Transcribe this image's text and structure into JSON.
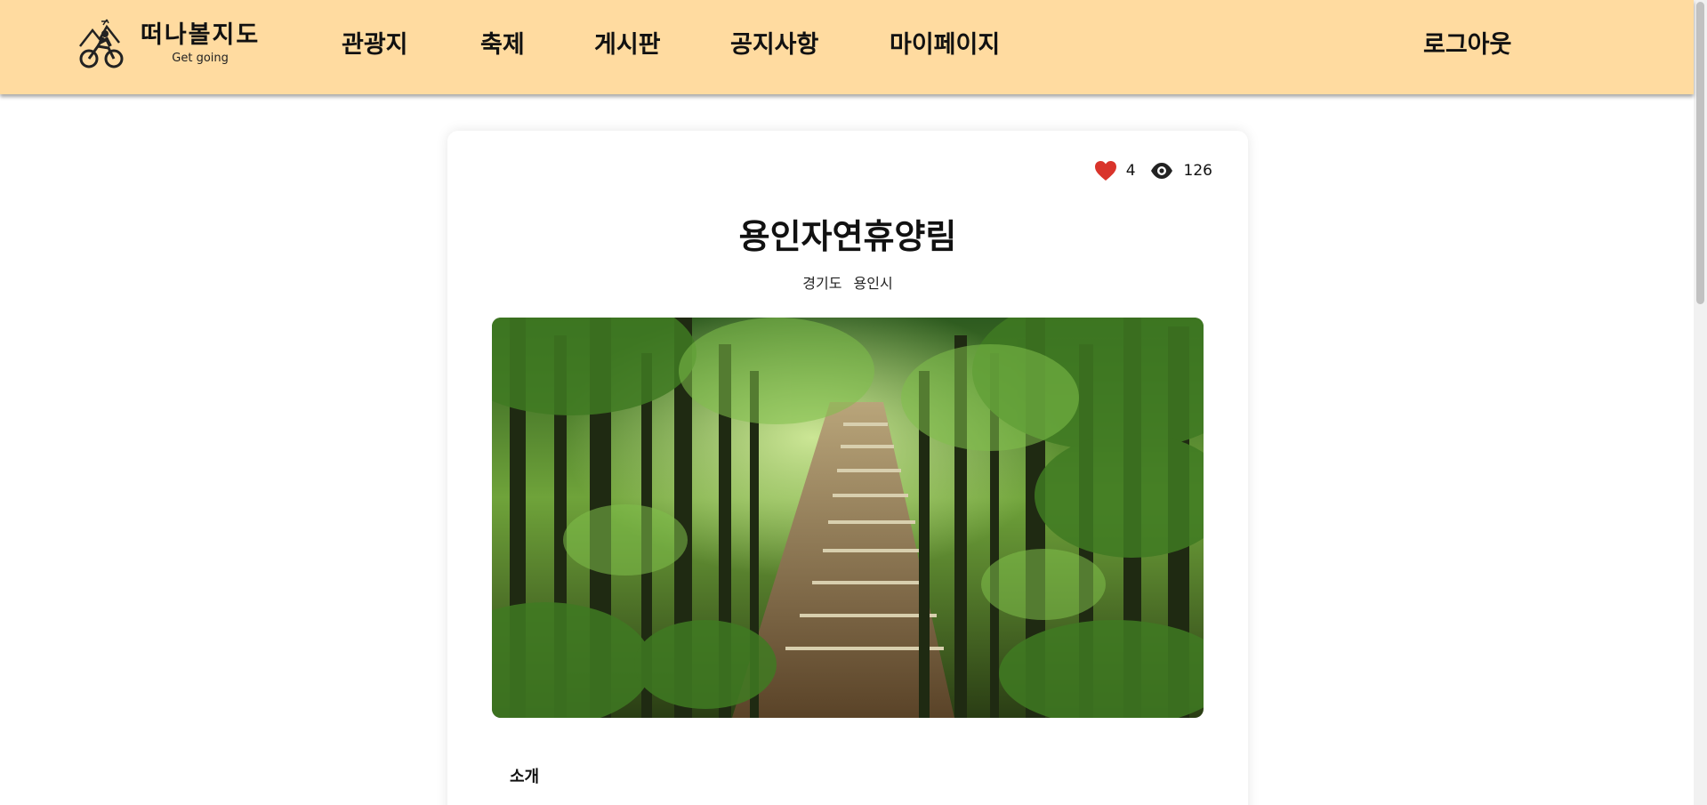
{
  "logo": {
    "name": "떠나볼지도",
    "subtitle": "Get going"
  },
  "nav": {
    "items": [
      {
        "label": "관광지"
      },
      {
        "label": "축제"
      },
      {
        "label": "게시판"
      },
      {
        "label": "공지사항"
      },
      {
        "label": "마이페이지"
      }
    ],
    "logout_label": "로그아웃"
  },
  "detail": {
    "likes": "4",
    "views": "126",
    "title": "용인자연휴양림",
    "province": "경기도",
    "city": "용인시",
    "photo_icon": "forest-path-photo",
    "section_intro": "소개"
  },
  "colors": {
    "header_bg": "#FFDBA0",
    "heart": "#D9342B"
  }
}
